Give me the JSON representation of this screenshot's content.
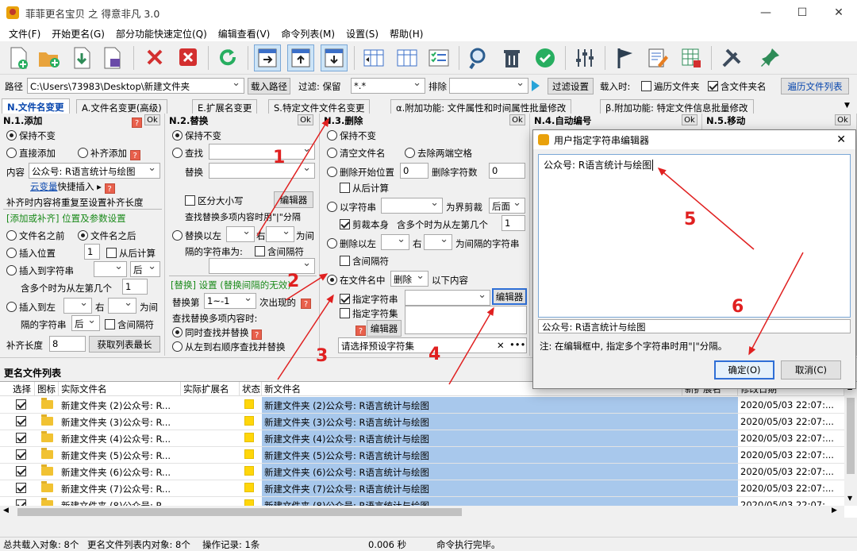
{
  "window": {
    "title": "菲菲更名宝贝 之 得意非凡 3.0",
    "min": "—",
    "max": "☐",
    "close": "✕"
  },
  "menu": [
    "文件(F)",
    "开始更名(G)",
    "部分功能快速定位(Q)",
    "编辑查看(V)",
    "命令列表(M)",
    "设置(S)",
    "帮助(H)"
  ],
  "toolbar": {
    "icons": [
      "new-file-icon",
      "open-folder-icon",
      "import-icon",
      "export-icon",
      "delete-x-icon",
      "delete-box-icon",
      "refresh-icon",
      "move-right-icon",
      "move-up-icon",
      "move-down-icon",
      "columns-left-icon",
      "columns-icon",
      "checklist-icon",
      "search-user-icon",
      "trash-icon",
      "check-circle-icon",
      "sliders-icon",
      "flag-icon",
      "edit-doc-icon",
      "grid-edit-icon",
      "tools-icon",
      "pin-icon"
    ]
  },
  "pathbar": {
    "path_label": "路径",
    "path_value": "C:\\Users\\73983\\Desktop\\新建文件夹",
    "load_path": "载入路径",
    "filter_label": "过滤: 保留",
    "filter_value": "*.*",
    "exclude_label": "排除",
    "exclude_value": "",
    "filter_settings": "过滤设置",
    "load_time_label": "载入时:",
    "traverse_folder": "遍历文件夹",
    "include_folder_name": "含文件夹名",
    "traverse_list": "遍历文件列表"
  },
  "tabs": [
    "N.文件名变更",
    "A.文件名变更(高级)",
    "E.扩展名变更",
    "S.特定文件文件名变更",
    "α.附加功能: 文件属性和时间属性批量修改",
    "β.附加功能: 特定文件信息批量修改"
  ],
  "p1": {
    "title": "N.1.添加",
    "ok": "Ok",
    "q": "?",
    "keep": "保持不变",
    "direct_add": "直接添加",
    "pad_add": "补齐添加",
    "content_label": "内容",
    "content_value": "公众号: R语言统计与绘图",
    "var_link": "云变量",
    "quick_insert": "快捷插入",
    "pad_note": "补齐时内容将重复至设置补齐长度",
    "sec_title": "[添加或补齐] 位置及参数设置",
    "before_name": "文件名之前",
    "after_name": "文件名之后",
    "insert_pos": "插入位置",
    "insert_pos_val": "1",
    "from_end": "从后计算",
    "insert_to_str": "插入到字符串",
    "after": "后",
    "multi_from_left": "含多个时为从左第几个",
    "multi_val": "1",
    "insert_between": "插入到左",
    "right": "右",
    "between": "为间",
    "gap_str": "隔的字符串",
    "gap_after": "后",
    "gap_contain": "含间隔符",
    "pad_len_label": "补齐长度",
    "pad_len_val": "8",
    "get_max": "获取列表最长"
  },
  "p2": {
    "title": "N.2.替换",
    "ok": "Ok",
    "keep": "保持不变",
    "find": "查找",
    "replace": "替换",
    "case": "区分大小写",
    "editor": "编辑器",
    "multi_note": "查找替换多项内容时用\"|\"分隔",
    "replace_between": "替换以左",
    "right": "右",
    "between": "为间",
    "gap_str": "隔的字符串为:",
    "gap_contain": "含间隔符",
    "sec_title": "[替换] 设置 (替换间隔的无效)",
    "nth_label": "替换第",
    "nth_val": "1~-1",
    "nth_suffix": "次出现的",
    "multi_label": "查找替换多项内容时:",
    "opt1": "同时查找并替换",
    "opt2": "从左到右顺序查找并替换",
    "q": "?"
  },
  "p3": {
    "title": "N.3.删除",
    "ok": "Ok",
    "keep": "保持不变",
    "clear_name": "清空文件名",
    "trim": "去除两端空格",
    "del_start": "删除开始位置",
    "del_start_val": "0",
    "del_count": "删除字符数",
    "del_count_val": "0",
    "from_end": "从后计算",
    "by_str": "以字符串",
    "boundary": "为界剪裁",
    "after": "后面",
    "cut_self": "剪裁本身",
    "multi_from_left": "含多个时为从左第几个",
    "multi_val": "1",
    "del_between": "删除以左",
    "right": "右",
    "between_str": "为间隔的字符串",
    "gap_contain": "含间隔符",
    "in_name": "在文件名中",
    "del_mode": "删除",
    "below": "以下内容",
    "spec_str": "指定字符串",
    "editor": "编辑器",
    "spec_set": "指定字符集",
    "editor2": "编辑器",
    "q": "?",
    "preset_placeholder": "请选择预设字符集",
    "x": "✕",
    "dots": "•••"
  },
  "p4": {
    "title": "N.4.自动编号",
    "ok": "Ok"
  },
  "p5": {
    "title": "N.5.移动",
    "ok": "Ok"
  },
  "list": {
    "title": "更名文件列表",
    "headers": [
      "选择",
      "图标",
      "实际文件名",
      "实际扩展名",
      "状态",
      "新文件名",
      "新扩展名",
      "修改日期"
    ],
    "rows": [
      {
        "name": "新建文件夹 (2)公众号: R...",
        "new": "新建文件夹 (2)公众号: R语言统计与绘图",
        "date": "2020/05/03 22:07:..."
      },
      {
        "name": "新建文件夹 (3)公众号: R...",
        "new": "新建文件夹 (3)公众号: R语言统计与绘图",
        "date": "2020/05/03 22:07:..."
      },
      {
        "name": "新建文件夹 (4)公众号: R...",
        "new": "新建文件夹 (4)公众号: R语言统计与绘图",
        "date": "2020/05/03 22:07:..."
      },
      {
        "name": "新建文件夹 (5)公众号: R...",
        "new": "新建文件夹 (5)公众号: R语言统计与绘图",
        "date": "2020/05/03 22:07:..."
      },
      {
        "name": "新建文件夹 (6)公众号: R...",
        "new": "新建文件夹 (6)公众号: R语言统计与绘图",
        "date": "2020/05/03 22:07:..."
      },
      {
        "name": "新建文件夹 (7)公众号: R...",
        "new": "新建文件夹 (7)公众号: R语言统计与绘图",
        "date": "2020/05/03 22:07:..."
      },
      {
        "name": "新建文件夹 (8)公众号: R...",
        "new": "新建文件夹 (8)公众号: R语言统计与绘图",
        "date": "2020/05/03 22:07:..."
      }
    ]
  },
  "status": {
    "total": "总共载入对象: 8个",
    "in_list": "更名文件列表内对象: 8个",
    "ops": "操作记录: 1条",
    "time": "0.006 秒",
    "done": "命令执行完毕。"
  },
  "dialog": {
    "title": "用户指定字符串编辑器",
    "content": "公众号: R语言统计与绘图",
    "preview": "公众号: R语言统计与绘图",
    "note": "注: 在编辑框中, 指定多个字符串时用\"|\"分隔。",
    "ok": "确定(O)",
    "cancel": "取消(C)",
    "close": "✕"
  },
  "annotations": [
    "1",
    "2",
    "3",
    "4",
    "5",
    "6"
  ],
  "colors": {
    "accent": "#0645ad",
    "annotation": "#e02020",
    "selection": "#a8c8ec"
  }
}
